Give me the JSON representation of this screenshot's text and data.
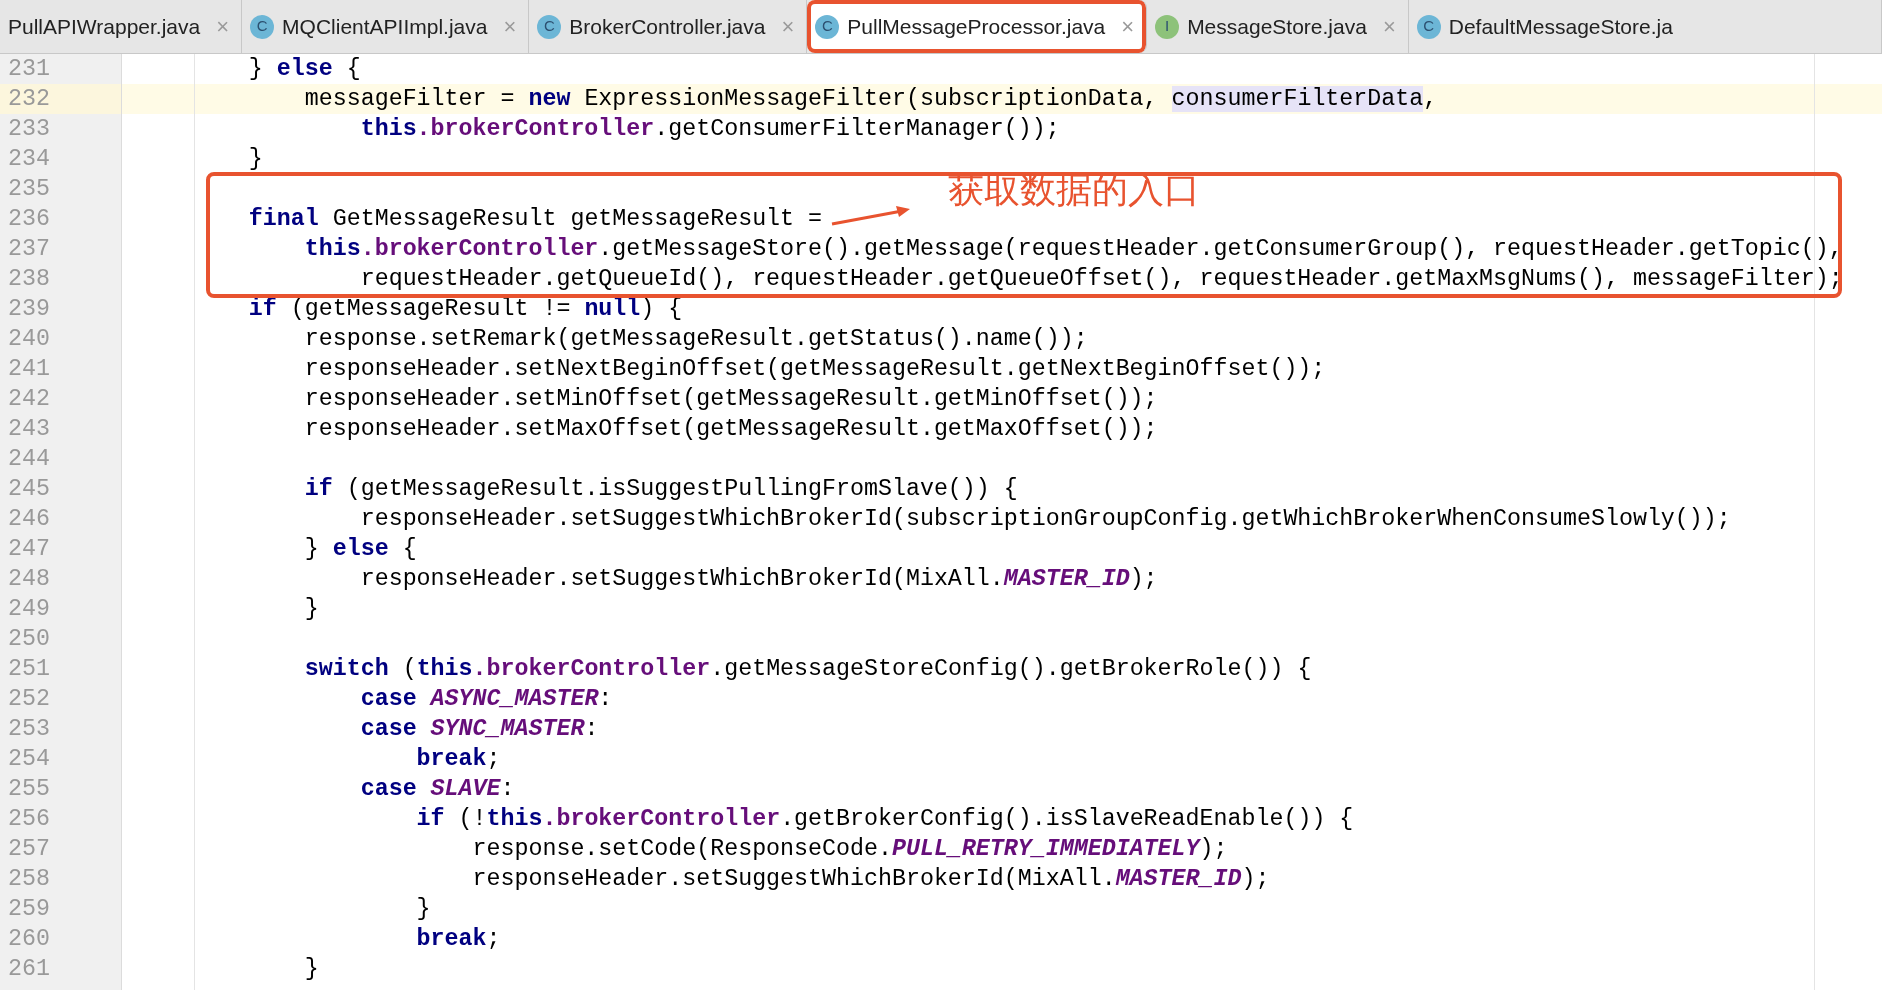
{
  "tabs": [
    {
      "label": "PullAPIWrapper.java",
      "selected": false,
      "outlined": false,
      "closable": true
    },
    {
      "label": "MQClientAPIImpl.java",
      "icon": "C",
      "color": "#6cb6d6",
      "selected": false,
      "outlined": false,
      "closable": true
    },
    {
      "label": "BrokerController.java",
      "icon": "C",
      "color": "#6cb6d6",
      "selected": false,
      "outlined": false,
      "closable": true
    },
    {
      "label": "PullMessageProcessor.java",
      "icon": "C",
      "color": "#6cb6d6",
      "selected": true,
      "outlined": true,
      "closable": true
    },
    {
      "label": "MessageStore.java",
      "icon": "I",
      "color": "#8dc27a",
      "selected": false,
      "outlined": false,
      "closable": true
    },
    {
      "label": "DefaultMessageStore.ja",
      "icon": "C",
      "color": "#6cb6d6",
      "selected": false,
      "outlined": false,
      "closable": false
    }
  ],
  "close_glyph": "×",
  "lines": [
    {
      "number": "231",
      "current": false,
      "tokens": [
        {
          "kind": "plain",
          "text": "        } "
        },
        {
          "kind": "keyword",
          "text": "else"
        },
        {
          "kind": "plain",
          "text": " {"
        }
      ]
    },
    {
      "number": "232",
      "current": true,
      "tokens": [
        {
          "kind": "plain",
          "text": "            messageFilter = "
        },
        {
          "kind": "keyword",
          "text": "new"
        },
        {
          "kind": "plain",
          "text": " ExpressionMessageFilter(subscriptionData, "
        },
        {
          "kind": "highlight",
          "text": "consumerFilterData"
        },
        {
          "kind": "plain",
          "text": ","
        }
      ]
    },
    {
      "number": "233",
      "current": false,
      "tokens": [
        {
          "kind": "keyword",
          "text": "                this"
        },
        {
          "kind": "field",
          "text": ".brokerController"
        },
        {
          "kind": "plain",
          "text": ".getConsumerFilterManager());"
        }
      ]
    },
    {
      "number": "234",
      "current": false,
      "tokens": [
        {
          "kind": "plain",
          "text": "        }"
        }
      ]
    },
    {
      "number": "235",
      "current": false
    },
    {
      "number": "236",
      "current": false,
      "tokens": [
        {
          "kind": "keyword",
          "text": "        final"
        },
        {
          "kind": "plain",
          "text": " GetMessageResult getMessageResult ="
        }
      ]
    },
    {
      "number": "237",
      "current": false,
      "tokens": [
        {
          "kind": "keyword",
          "text": "            this"
        },
        {
          "kind": "field",
          "text": ".brokerController"
        },
        {
          "kind": "plain",
          "text": ".getMessageStore().getMessage(requestHeader.getConsumerGroup(), requestHeader.getTopic(),"
        }
      ]
    },
    {
      "number": "238",
      "current": false,
      "tokens": [
        {
          "kind": "plain",
          "text": "                requestHeader.getQueueId(), requestHeader.getQueueOffset(), requestHeader.getMaxMsgNums(), messageFilter);"
        }
      ]
    },
    {
      "number": "239",
      "current": false,
      "tokens": [
        {
          "kind": "keyword",
          "text": "        if"
        },
        {
          "kind": "plain",
          "text": " (getMessageResult != "
        },
        {
          "kind": "keyword",
          "text": "null"
        },
        {
          "kind": "plain",
          "text": ") {"
        }
      ]
    },
    {
      "number": "240",
      "current": false,
      "tokens": [
        {
          "kind": "plain",
          "text": "            response.setRemark(getMessageResult.getStatus().name());"
        }
      ]
    },
    {
      "number": "241",
      "current": false,
      "tokens": [
        {
          "kind": "plain",
          "text": "            responseHeader.setNextBeginOffset(getMessageResult.getNextBeginOffset());"
        }
      ]
    },
    {
      "number": "242",
      "current": false,
      "tokens": [
        {
          "kind": "plain",
          "text": "            responseHeader.setMinOffset(getMessageResult.getMinOffset());"
        }
      ]
    },
    {
      "number": "243",
      "current": false,
      "tokens": [
        {
          "kind": "plain",
          "text": "            responseHeader.setMaxOffset(getMessageResult.getMaxOffset());"
        }
      ]
    },
    {
      "number": "244",
      "current": false
    },
    {
      "number": "245",
      "current": false,
      "tokens": [
        {
          "kind": "keyword",
          "text": "            if"
        },
        {
          "kind": "plain",
          "text": " (getMessageResult.isSuggestPullingFromSlave()) {"
        }
      ]
    },
    {
      "number": "246",
      "current": false,
      "tokens": [
        {
          "kind": "plain",
          "text": "                responseHeader.setSuggestWhichBrokerId(subscriptionGroupConfig.getWhichBrokerWhenConsumeSlowly());"
        }
      ]
    },
    {
      "number": "247",
      "current": false,
      "tokens": [
        {
          "kind": "plain",
          "text": "            } "
        },
        {
          "kind": "keyword",
          "text": "else"
        },
        {
          "kind": "plain",
          "text": " {"
        }
      ]
    },
    {
      "number": "248",
      "current": false,
      "tokens": [
        {
          "kind": "plain",
          "text": "                responseHeader.setSuggestWhichBrokerId(MixAll."
        },
        {
          "kind": "constant",
          "text": "MASTER_ID"
        },
        {
          "kind": "plain",
          "text": ");"
        }
      ]
    },
    {
      "number": "249",
      "current": false,
      "tokens": [
        {
          "kind": "plain",
          "text": "            }"
        }
      ]
    },
    {
      "number": "250",
      "current": false
    },
    {
      "number": "251",
      "current": false,
      "tokens": [
        {
          "kind": "keyword",
          "text": "            switch"
        },
        {
          "kind": "plain",
          "text": " ("
        },
        {
          "kind": "keyword",
          "text": "this"
        },
        {
          "kind": "field",
          "text": ".brokerController"
        },
        {
          "kind": "plain",
          "text": ".getMessageStoreConfig().getBrokerRole()) {"
        }
      ]
    },
    {
      "number": "252",
      "current": false,
      "tokens": [
        {
          "kind": "keyword",
          "text": "                case "
        },
        {
          "kind": "constant",
          "text": "ASYNC_MASTER"
        },
        {
          "kind": "plain",
          "text": ":"
        }
      ]
    },
    {
      "number": "253",
      "current": false,
      "tokens": [
        {
          "kind": "keyword",
          "text": "                case "
        },
        {
          "kind": "constant",
          "text": "SYNC_MASTER"
        },
        {
          "kind": "plain",
          "text": ":"
        }
      ]
    },
    {
      "number": "254",
      "current": false,
      "tokens": [
        {
          "kind": "keyword",
          "text": "                    break"
        },
        {
          "kind": "plain",
          "text": ";"
        }
      ]
    },
    {
      "number": "255",
      "current": false,
      "tokens": [
        {
          "kind": "keyword",
          "text": "                case "
        },
        {
          "kind": "constant",
          "text": "SLAVE"
        },
        {
          "kind": "plain",
          "text": ":"
        }
      ]
    },
    {
      "number": "256",
      "current": false,
      "tokens": [
        {
          "kind": "keyword",
          "text": "                    if"
        },
        {
          "kind": "plain",
          "text": " (!"
        },
        {
          "kind": "keyword",
          "text": "this"
        },
        {
          "kind": "field",
          "text": ".brokerController"
        },
        {
          "kind": "plain",
          "text": ".getBrokerConfig().isSlaveReadEnable()) {"
        }
      ]
    },
    {
      "number": "257",
      "current": false,
      "tokens": [
        {
          "kind": "plain",
          "text": "                        response.setCode(ResponseCode."
        },
        {
          "kind": "constant",
          "text": "PULL_RETRY_IMMEDIATELY"
        },
        {
          "kind": "plain",
          "text": ");"
        }
      ]
    },
    {
      "number": "258",
      "current": false,
      "tokens": [
        {
          "kind": "plain",
          "text": "                        responseHeader.setSuggestWhichBrokerId(MixAll."
        },
        {
          "kind": "constant",
          "text": "MASTER_ID"
        },
        {
          "kind": "plain",
          "text": ");"
        }
      ]
    },
    {
      "number": "259",
      "current": false,
      "tokens": [
        {
          "kind": "plain",
          "text": "                    }"
        }
      ]
    },
    {
      "number": "260",
      "current": false,
      "tokens": [
        {
          "kind": "keyword",
          "text": "                    break"
        },
        {
          "kind": "plain",
          "text": ";"
        }
      ]
    },
    {
      "number": "261",
      "current": false,
      "tokens": [
        {
          "kind": "plain",
          "text": "            }"
        }
      ]
    }
  ],
  "annotation": {
    "text": "获取数据的入口"
  }
}
